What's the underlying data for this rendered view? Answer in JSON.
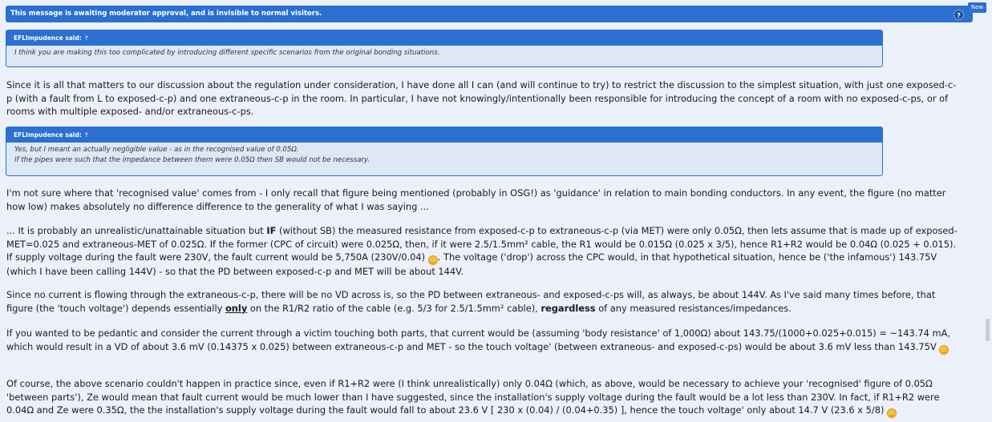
{
  "banner": {
    "text": "This message is awaiting moderator approval, and is invisible to normal visitors.",
    "help_symbol": "?",
    "new_badge": "New"
  },
  "quote1": {
    "author_line": "EFLImpudence said:",
    "arrow": "↑",
    "lines": [
      "I think you are making this too complicated by introducing different specific scenarios from the original bonding situations."
    ]
  },
  "para1": "Since it is all that matters to our discussion about the regulation under consideration, I have done all I can (and will continue to try) to restrict the discussion to the simplest situation, with just one exposed-c-p (with a fault from L to exposed-c-p) and one extraneous-c-p in the room. In particular, I have not knowingly/intentionally been responsible for introducing the concept of a room with no exposed-c-ps, or of rooms with multiple exposed- and/or extraneous-c-ps.",
  "quote2": {
    "author_line": "EFLImpudence said:",
    "arrow": "↑",
    "lines": [
      "Yes, but I meant an actually negligible value - as in the recognised value of 0.05Ω.",
      "If the pipes were such that the impedance between them were 0.05Ω then SB would not be necessary."
    ]
  },
  "para2": "I'm not sure where that 'recognised value' comes from - I only recall that figure being mentioned (probably in OSG!) as 'guidance' in relation to main bonding conductors. In any event, the figure (no matter how low) makes absolutely no difference difference to the generality of what I was saying ...",
  "para3": {
    "a": "... It is probably an unrealistic/unattainable situation but",
    "b": "IF",
    "c": "(without SB) the measured resistance from exposed-c-p to extraneous-c-p (via MET) were only 0.05Ω, then lets assume that is made up of exposed-MET=0.025 and extraneous-MET of 0.025Ω. If the former (CPC of circuit) were 0.025Ω, then, if it were 2.5/1.5mm² cable, the R1 would be 0.015Ω (0.025 x 3/5), hence R1+R2 would be 0.04Ω (0.025 + 0.015). If supply voltage during the fault were 230V, the fault current would be 5,750A (230V/0.04)",
    "d": ". The voltage ('drop') across the CPC would, in that hypothetical situation, hence be ('the infamous') 143.75V (which I have been calling 144V) - so that the PD between exposed-c-p and MET will be about 144V."
  },
  "para4": {
    "a": "Since no current is flowing through the extraneous-c-p, there will be no VD across is, so the PD between extraneous- and exposed-c-ps will, as always, be about 144V. As I've said many times before, that figure (the 'touch voltage') depends essentially",
    "b": "only",
    "c": "on the R1/R2 ratio of the cable (e.g. 5/3 for 2.5/1.5mm² cable),",
    "d": "regardless",
    "e": "of any measured resistances/impedances."
  },
  "para5": "If you wanted to be pedantic and consider the current through a victim touching both parts, that current would be (assuming 'body resistance' of 1,000Ω) about 143.75/(1000+0.025+0.015) = ~143.74 mA, which would result in a VD of about 3.6 mV (0.14375 x 0.025) between extraneous-c-p and MET - so the touch voltage' (between extraneous- and exposed-c-ps) would be about 3.6 mV less than 143.75V",
  "para6": "Of course, the above scenario couldn't happen in practice since, even if R1+R2 were (I think unrealistically) only 0.04Ω (which, as above, would be necessary to achieve your 'recognised' figure of 0.05Ω 'between parts'), Ze would mean that fault current would be much lower than I have suggested, since the installation's supply voltage during the fault would be a lot less than 230V. In fact, if R1+R2 were 0.04Ω and Ze were 0.35Ω, the the installation's supply voltage during the fault would fall to about 23.6 V [ 230 x (0.04) / (0.04+0.35) ], hence the touch voltage' only about 14.7 V (23.6 x 5/8)",
  "colors": {
    "accent": "#2b6fd1",
    "page_bg": "#ecf1f9",
    "quote_bg": "#dde7f5"
  },
  "icons": {
    "help": "help-icon",
    "quote_arrow": "up-arrow-icon",
    "smiley": "smiley-emoji-icon"
  }
}
